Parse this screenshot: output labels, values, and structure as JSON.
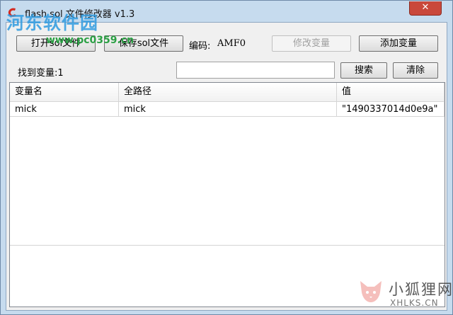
{
  "window": {
    "title": "flash sol 文件修改器 v1.3",
    "close_symbol": "✕"
  },
  "watermark": {
    "site_name": "河东软件园",
    "site_url": "www.pc0359.cn"
  },
  "toolbar": {
    "open_label": "打开sol文件",
    "save_label": "保存sol文件",
    "encoding_label": "编码:",
    "encoding_value": "AMF0",
    "modify_label": "修改变量",
    "add_label": "添加变量"
  },
  "search": {
    "found_label": "找到变量:1",
    "value": "",
    "search_label": "搜索",
    "clear_label": "清除"
  },
  "grid": {
    "columns": [
      "变量名",
      "全路径",
      "值"
    ],
    "rows": [
      [
        "mick",
        "mick",
        "\"1490337014d0e9a\""
      ]
    ]
  },
  "bottom_logo": {
    "text": "小狐狸网",
    "url": "XHLKS.CN"
  },
  "colors": {
    "window_frame": "#c6dbee",
    "close_button": "#c9483b",
    "client_bg": "#f0f0f0"
  }
}
